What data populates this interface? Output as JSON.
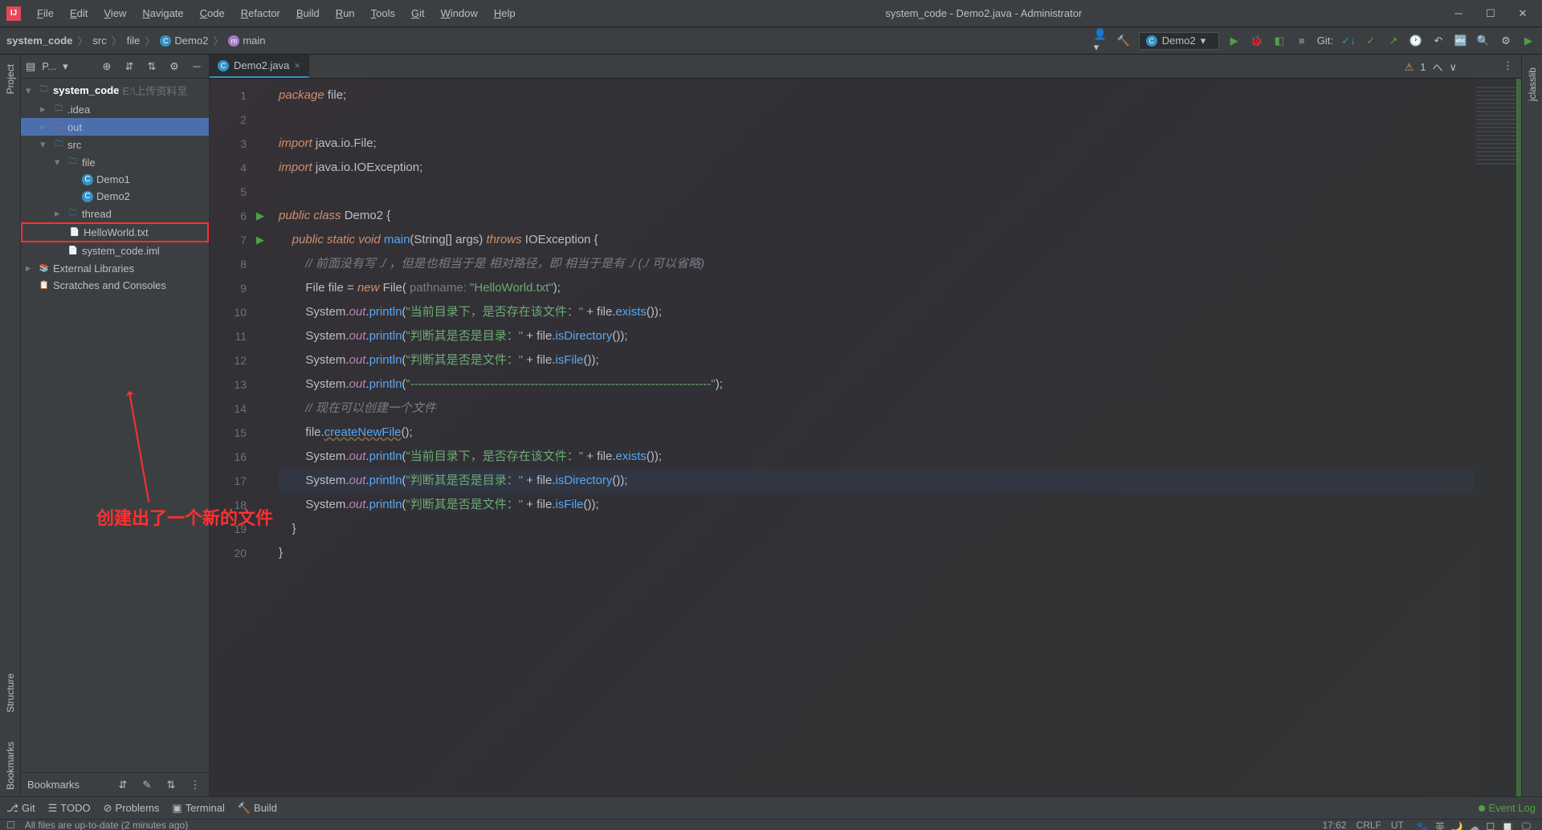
{
  "title": "system_code - Demo2.java - Administrator",
  "menu": [
    "File",
    "Edit",
    "View",
    "Navigate",
    "Code",
    "Refactor",
    "Build",
    "Run",
    "Tools",
    "Git",
    "Window",
    "Help"
  ],
  "breadcrumb": [
    {
      "label": "system_code",
      "icon": null,
      "bold": true
    },
    {
      "label": "src",
      "icon": null
    },
    {
      "label": "file",
      "icon": null
    },
    {
      "label": "Demo2",
      "icon": "class"
    },
    {
      "label": "main",
      "icon": "method"
    }
  ],
  "run_config": "Demo2",
  "git_label": "Git:",
  "project_toolbar_label": "P...",
  "project_tree": [
    {
      "depth": 0,
      "chev": "▾",
      "icon": "📁",
      "label": "system_code",
      "suffix": " E:\\上传资料至",
      "bold": true
    },
    {
      "depth": 1,
      "chev": "▸",
      "icon": "📁",
      "label": ".idea"
    },
    {
      "depth": 1,
      "chev": "▸",
      "icon": "📁",
      "label": "out",
      "sel": true,
      "folder_color": "#db5c5c"
    },
    {
      "depth": 1,
      "chev": "▾",
      "icon": "📁",
      "label": "src",
      "folder_color": "#3592c4"
    },
    {
      "depth": 2,
      "chev": "▾",
      "icon": "📁",
      "label": "file",
      "folder_color": "#3592c4"
    },
    {
      "depth": 3,
      "chev": "",
      "icon": "C",
      "label": "Demo1",
      "icon_bg": "#3592c4"
    },
    {
      "depth": 3,
      "chev": "",
      "icon": "C",
      "label": "Demo2",
      "icon_bg": "#3592c4"
    },
    {
      "depth": 2,
      "chev": "▸",
      "icon": "📁",
      "label": "thread",
      "folder_color": "#3592c4"
    },
    {
      "depth": 2,
      "chev": "",
      "icon": "📄",
      "label": "HelloWorld.txt",
      "red_box": true
    },
    {
      "depth": 2,
      "chev": "",
      "icon": "📄",
      "label": "system_code.iml"
    },
    {
      "depth": 0,
      "chev": "▸",
      "icon": "📚",
      "label": "External Libraries"
    },
    {
      "depth": 0,
      "chev": "",
      "icon": "📋",
      "label": "Scratches and Consoles"
    }
  ],
  "annotation_text": "创建出了一个新的文件",
  "open_tab": "Demo2.java",
  "inspection": {
    "warnings": "1"
  },
  "gutter_lines": 20,
  "run_markers": [
    6,
    7
  ],
  "highlight_line": 17,
  "code_lines": [
    {
      "n": 1,
      "html": "<span class='kw'>package</span> file;"
    },
    {
      "n": 2,
      "html": ""
    },
    {
      "n": 3,
      "html": "<span class='kw'>import</span> java.io.File;"
    },
    {
      "n": 4,
      "html": "<span class='kw'>import</span> java.io.IOException;"
    },
    {
      "n": 5,
      "html": ""
    },
    {
      "n": 6,
      "html": "<span class='kw'>public class</span> <span class='cls'>Demo2</span> {"
    },
    {
      "n": 7,
      "html": "    <span class='kw'>public static void</span> <span class='mth'>main</span>(String[] args) <span class='kw'>throws</span> IOException {"
    },
    {
      "n": 8,
      "html": "        <span class='cmt'>// 前面没有写 ./ ，但是也相当于是 相对路径，即 相当于是有 ./ (./ 可以省略)</span>"
    },
    {
      "n": 9,
      "html": "        File file = <span class='kw'>new</span> File( <span class='ann-hint'>pathname:</span> <span class='str'>\"HelloWorld.txt\"</span>);"
    },
    {
      "n": 10,
      "html": "        System.<span class='fld'>out</span>.<span class='mth'>println</span>(<span class='str'>\"当前目录下，是否存在该文件：\"</span> + file.<span class='mth'>exists</span>());"
    },
    {
      "n": 11,
      "html": "        System.<span class='fld'>out</span>.<span class='mth'>println</span>(<span class='str'>\"判断其是否是目录：\"</span> + file.<span class='mth'>isDirectory</span>());"
    },
    {
      "n": 12,
      "html": "        System.<span class='fld'>out</span>.<span class='mth'>println</span>(<span class='str'>\"判断其是否是文件：\"</span> + file.<span class='mth'>isFile</span>());"
    },
    {
      "n": 13,
      "html": "        System.<span class='fld'>out</span>.<span class='mth'>println</span>(<span class='str'>\"---------------------------------------------------------------------------\"</span>);"
    },
    {
      "n": 14,
      "html": "        <span class='cmt'>// 现在可以创建一个文件</span>"
    },
    {
      "n": 15,
      "html": "        file.<span class='mth wavy'>createNewFile</span>();"
    },
    {
      "n": 16,
      "html": "        System.<span class='fld'>out</span>.<span class='mth'>println</span>(<span class='str'>\"当前目录下，是否存在该文件：\"</span> + file.<span class='mth'>exists</span>());"
    },
    {
      "n": 17,
      "html": "        System.<span class='fld'>out</span>.<span class='mth'>println</span>(<span class='str'>\"判断其是否是目录：\"</span> + file.<span class='mth'>isDirectory</span>());"
    },
    {
      "n": 18,
      "html": "        System.<span class='fld'>out</span>.<span class='mth'>println</span>(<span class='str'>\"判断其是否是文件：\"</span> + file.<span class='mth'>isFile</span>());"
    },
    {
      "n": 19,
      "html": "    }"
    },
    {
      "n": 20,
      "html": "}"
    }
  ],
  "left_tool_labels": [
    "Project",
    "Structure",
    "Bookmarks"
  ],
  "right_tool_label": "jclasslib",
  "bookmarks_label": "Bookmarks",
  "bottom_tools": [
    {
      "icon": "⎇",
      "label": "Git"
    },
    {
      "icon": "☰",
      "label": "TODO"
    },
    {
      "icon": "⊘",
      "label": "Problems"
    },
    {
      "icon": "▣",
      "label": "Terminal"
    },
    {
      "icon": "🔨",
      "label": "Build"
    }
  ],
  "event_log": "Event Log",
  "status_left": "All files are up-to-date (2 minutes ago)",
  "status_right": [
    "17:62",
    "CRLF",
    "UT"
  ],
  "tray_icons": [
    "🐾",
    "英",
    "🌙",
    "☁",
    "口",
    "🔲",
    "🗯"
  ]
}
